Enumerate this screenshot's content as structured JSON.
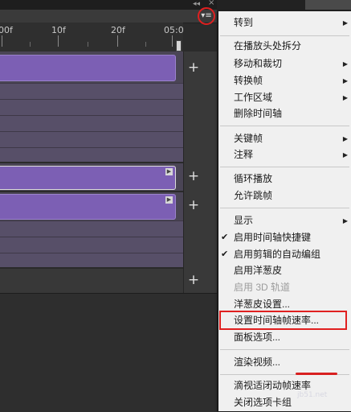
{
  "panel": {
    "collapse_glyph": "◂◂",
    "close_glyph": "×",
    "menu_glyph": "▾≡"
  },
  "ruler": {
    "labels": [
      "00f",
      "10f",
      "20f",
      "05:0"
    ]
  },
  "tracks": {
    "plus_glyph": "+",
    "marker_glyph": "▶"
  },
  "menu": {
    "items": [
      {
        "label": "转到",
        "submenu": true
      },
      {
        "label": "在播放头处拆分"
      },
      {
        "label": "移动和裁切",
        "submenu": true
      },
      {
        "label": "转换帧",
        "submenu": true
      },
      {
        "label": "工作区域",
        "submenu": true
      },
      {
        "label": "删除时间轴"
      },
      {
        "label": "关键帧",
        "submenu": true
      },
      {
        "label": "注释",
        "submenu": true
      },
      {
        "label": "循环播放"
      },
      {
        "label": "允许跳帧"
      },
      {
        "label": "显示",
        "submenu": true
      },
      {
        "label": "启用时间轴快捷键",
        "checked": true
      },
      {
        "label": "启用剪辑的自动编组",
        "checked": true
      },
      {
        "label": "启用洋葱皮"
      },
      {
        "label": "启用 3D 轨道",
        "disabled": true
      },
      {
        "label": "洋葱皮设置..."
      },
      {
        "label": "设置时间轴帧速率..."
      },
      {
        "label": "面板选项..."
      },
      {
        "label": "渲染视频..."
      },
      {
        "label": "滴视适闭动帧速率"
      },
      {
        "label": "关闭选项卡组"
      }
    ],
    "check_glyph": "✔",
    "arrow_glyph": "▶"
  },
  "watermark": "jb51.net"
}
